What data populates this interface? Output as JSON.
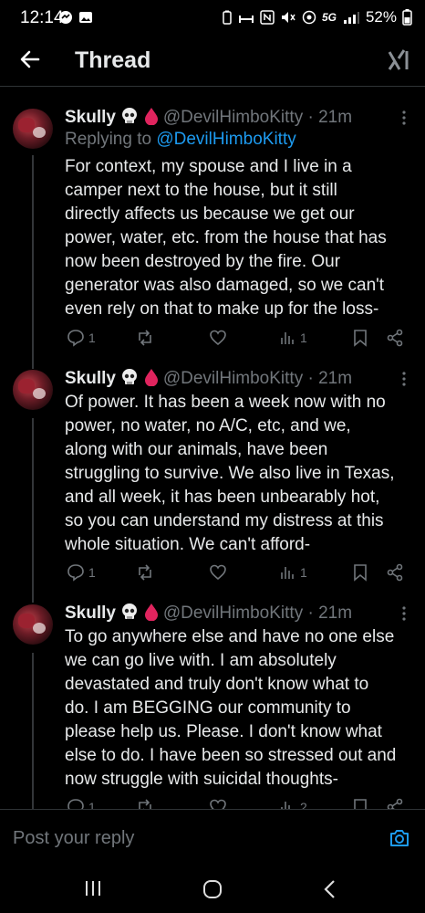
{
  "status_bar": {
    "time": "12:14",
    "battery": "52%",
    "network": "5G"
  },
  "header": {
    "title": "Thread"
  },
  "tweets": [
    {
      "name": "Skully",
      "handle": "@DevilHimboKitty",
      "time": "· 21m",
      "replying_prefix": "Replying to ",
      "replying_to": "@DevilHimboKitty",
      "lines": [
        "For context, my spouse and I live in a",
        "camper next to the house, but it still",
        "directly affects us because we get our",
        "power, water, etc. from the house that has",
        "now been destroyed by the fire. Our",
        "generator was also damaged, so we can't",
        "even rely on that to make up for the loss-"
      ],
      "replies": "1",
      "views": "1"
    },
    {
      "name": "Skully",
      "handle": "@DevilHimboKitty",
      "time": "· 21m",
      "lines": [
        "Of power. It has been a week now with no",
        "power, no water, no A/C, etc, and we,",
        "along with our animals, have been",
        "struggling to survive. We also live in Texas,",
        "and all week, it has been unbearably hot,",
        "so you can understand my distress at this",
        "whole situation. We can't afford-"
      ],
      "replies": "1",
      "views": "1"
    },
    {
      "name": "Skully",
      "handle": "@DevilHimboKitty",
      "time": "· 21m",
      "lines": [
        "To go anywhere else and have no one else",
        "we can go live with. I am absolutely",
        "devastated and truly don't know what to",
        "do. I am BEGGING our community to",
        "please help us. Please. I don't know what",
        "else to do. I have been so stressed out and",
        "now struggle with suicidal thoughts-"
      ],
      "replies": "1",
      "views": "2"
    }
  ],
  "reply_bar": {
    "placeholder": "Post your reply"
  },
  "icons": {
    "back": "arrow-left-icon",
    "brand": "xai-grok-icon",
    "emoji1": "skull-emoji",
    "emoji2": "blood-drop-emoji",
    "camera": "camera-icon"
  },
  "colors": {
    "background": "#000000",
    "text": "#e7e9ea",
    "muted": "#71767b",
    "accent": "#1d9bf0",
    "divider": "#2f3336"
  }
}
